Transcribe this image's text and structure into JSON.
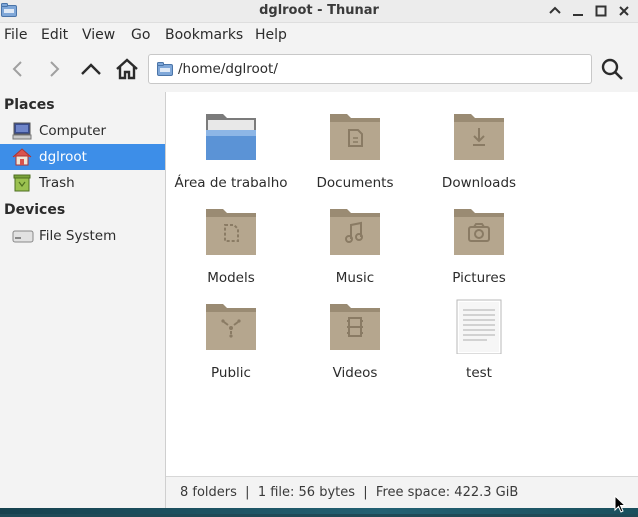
{
  "window": {
    "title": "dglroot - Thunar"
  },
  "menu": {
    "items": [
      {
        "label": "File"
      },
      {
        "label": "Edit"
      },
      {
        "label": "View"
      },
      {
        "label": "Go"
      },
      {
        "label": "Bookmarks"
      },
      {
        "label": "Help"
      }
    ]
  },
  "toolbar": {
    "buttons": [
      {
        "name": "back",
        "icon": "chevron-left-icon",
        "enabled": false
      },
      {
        "name": "forward",
        "icon": "chevron-right-icon",
        "enabled": false
      },
      {
        "name": "up",
        "icon": "chevron-up-icon",
        "enabled": true
      },
      {
        "name": "home",
        "icon": "home-icon",
        "enabled": true
      }
    ],
    "location": "/home/dglroot/",
    "search_icon": "search-icon"
  },
  "sidebar": {
    "places_heading": "Places",
    "places": [
      {
        "label": "Computer",
        "icon": "computer-icon",
        "selected": false
      },
      {
        "label": "dglroot",
        "icon": "user-home-icon",
        "selected": true
      },
      {
        "label": "Trash",
        "icon": "trash-icon",
        "selected": false
      }
    ],
    "devices_heading": "Devices",
    "devices": [
      {
        "label": "File System",
        "icon": "drive-icon",
        "selected": false
      }
    ]
  },
  "files": [
    {
      "label": "Área de trabalho",
      "icon": "desktop-folder-icon"
    },
    {
      "label": "Documents",
      "icon": "documents-folder-icon"
    },
    {
      "label": "Downloads",
      "icon": "downloads-folder-icon"
    },
    {
      "label": "Models",
      "icon": "templates-folder-icon"
    },
    {
      "label": "Music",
      "icon": "music-folder-icon"
    },
    {
      "label": "Pictures",
      "icon": "pictures-folder-icon"
    },
    {
      "label": "Public",
      "icon": "public-folder-icon"
    },
    {
      "label": "Videos",
      "icon": "videos-folder-icon"
    },
    {
      "label": "test",
      "icon": "text-file-icon"
    }
  ],
  "status": {
    "text": "8 folders  |  1 file: 56 bytes  |  Free space: 422.3 GiB"
  },
  "colors": {
    "selection": "#3d8ee8",
    "folder": "#b5a68e",
    "folder_dark": "#9a8b73",
    "desktop_folder": "#5b93d6"
  }
}
